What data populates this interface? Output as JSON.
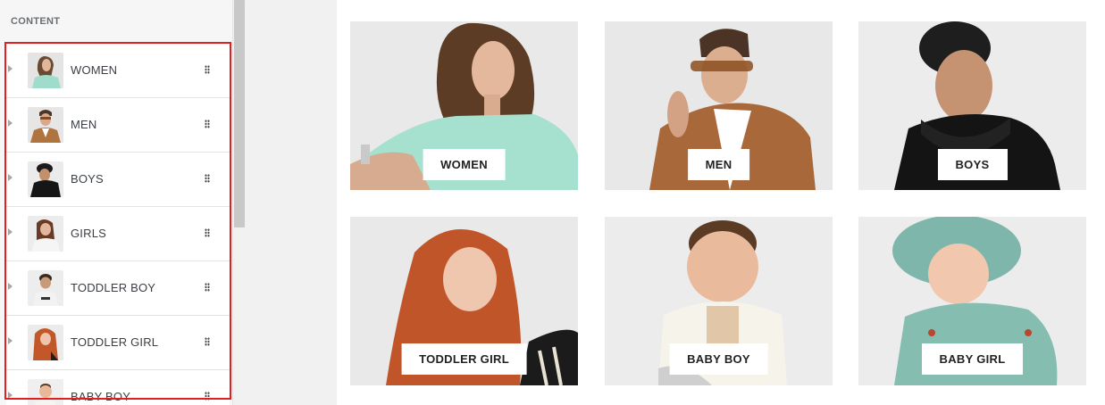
{
  "sidebar": {
    "section_title": "CONTENT",
    "items": [
      {
        "label": "WOMEN",
        "icon": "image-thumbnail-women"
      },
      {
        "label": "MEN",
        "icon": "image-thumbnail-men"
      },
      {
        "label": "BOYS",
        "icon": "image-thumbnail-boys"
      },
      {
        "label": "GIRLS",
        "icon": "image-thumbnail-girls"
      },
      {
        "label": "TODDLER BOY",
        "icon": "image-thumbnail-toddler-boy"
      },
      {
        "label": "TODDLER GIRL",
        "icon": "image-thumbnail-toddler-girl"
      },
      {
        "label": "BABY BOY",
        "icon": "image-thumbnail-baby-boy"
      }
    ]
  },
  "preview": {
    "tiles": [
      {
        "label": "WOMEN"
      },
      {
        "label": "MEN"
      },
      {
        "label": "BOYS"
      },
      {
        "label": "TODDLER GIRL"
      },
      {
        "label": "BABY BOY"
      },
      {
        "label": "BABY GIRL"
      }
    ]
  },
  "colors": {
    "highlight": "#e02020",
    "panel_bg": "#f6f6f6",
    "label_bg": "#ffffff",
    "text": "#222222"
  }
}
